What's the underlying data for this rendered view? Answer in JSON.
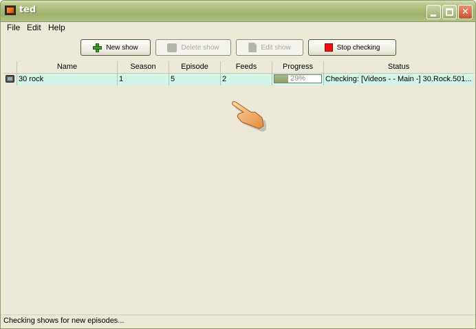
{
  "window": {
    "title": "ted"
  },
  "menu": {
    "items": [
      "File",
      "Edit",
      "Help"
    ]
  },
  "toolbar": {
    "new_show": "New show",
    "delete_show": "Delete show",
    "edit_show": "Edit show",
    "stop_checking": "Stop checking"
  },
  "table": {
    "columns": [
      "Name",
      "Season",
      "Episode",
      "Feeds",
      "Progress",
      "Status"
    ],
    "rows": [
      {
        "name": "30 rock",
        "season": "1",
        "episode": "5",
        "feeds": "2",
        "progress_percent": 29,
        "progress_label": "29%",
        "status": "Checking: [Videos - - Main -] 30.Rock.501..."
      }
    ]
  },
  "statusbar": {
    "text": "Checking shows for new episodes..."
  },
  "colors": {
    "row_highlight": "#d2f5e8",
    "titlebar": "#a8bb76",
    "stop_icon": "#ee1010",
    "add_icon": "#3c9c2a"
  },
  "icons": {
    "app": "ted-app-icon",
    "row": "tv-show-icon",
    "cursor": "hand-pointer-icon"
  }
}
